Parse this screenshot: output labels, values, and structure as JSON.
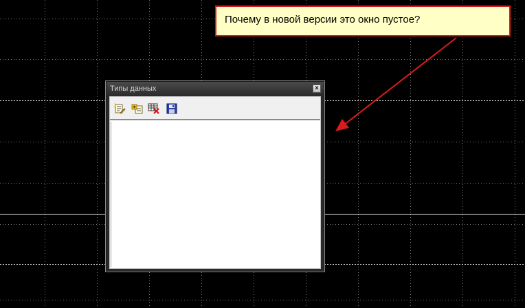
{
  "window": {
    "title": "Типы данных",
    "close_label": "×"
  },
  "toolbar": {
    "buttons": [
      {
        "name": "new-type",
        "icon": "edit-page-icon"
      },
      {
        "name": "add-type",
        "icon": "add-page-icon"
      },
      {
        "name": "delete-type",
        "icon": "delete-icon"
      },
      {
        "name": "save",
        "icon": "floppy-disk-icon"
      }
    ]
  },
  "list": {
    "items": []
  },
  "callout": {
    "text": "Почему в новой версии это окно пустое?"
  },
  "colors": {
    "background": "#000000",
    "grid": "#9a9a9a",
    "callout_fill": "#ffffc6",
    "callout_border": "#d81c1c",
    "arrow": "#d81c1c"
  }
}
